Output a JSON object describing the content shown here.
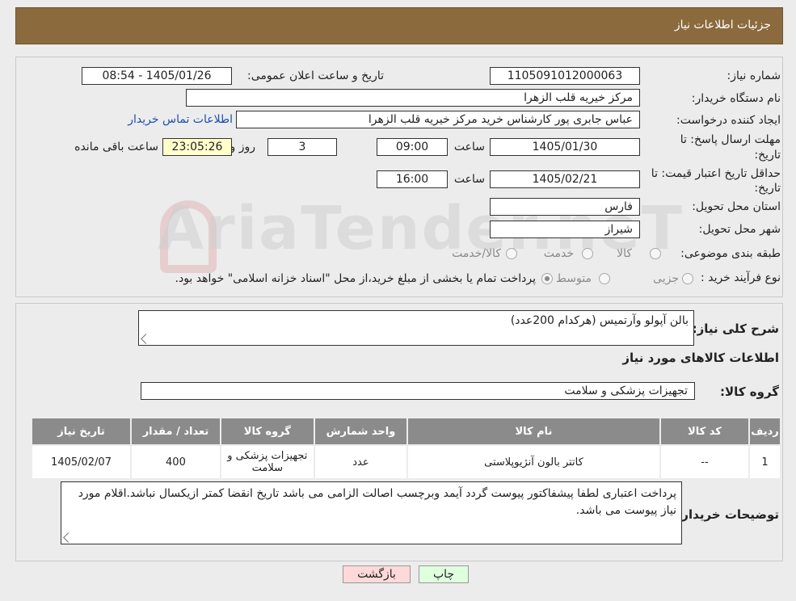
{
  "header": {
    "title": "جزئیات اطلاعات نیاز"
  },
  "form": {
    "need_number_label": "شماره نیاز:",
    "need_number": "1105091012000063",
    "announce_label": "تاریخ و ساعت اعلان عمومی:",
    "announce_value": "1405/01/26 - 08:54",
    "buyer_org_label": "نام دستگاه خریدار:",
    "buyer_org": "مرکز خیریه قلب الزهرا",
    "requester_label": "ایجاد کننده درخواست:",
    "requester": "عباس جابری پور کارشناس خرید مرکز خیریه قلب الزهرا",
    "contact_link": "اطلاعات تماس خریدار",
    "deadline_label_1": "مهلت ارسال پاسخ: تا",
    "deadline_label_2": "تاریخ:",
    "deadline_date": "1405/01/30",
    "time_label": "ساعت",
    "deadline_time": "09:00",
    "days_value": "3",
    "days_label": "روز و",
    "remaining_time": "23:05:26",
    "remaining_label": "ساعت باقی مانده",
    "validity_label_1": "حداقل تاریخ اعتبار قیمت: تا",
    "validity_label_2": "تاریخ:",
    "validity_date": "1405/02/21",
    "validity_time": "16:00",
    "province_label": "استان محل تحویل:",
    "province": "فارس",
    "city_label": "شهر محل تحویل:",
    "city": "شیراز",
    "category_label": "طبقه بندی موضوعی:",
    "category_options": [
      "کالا",
      "خدمت",
      "کالا/خدمت"
    ],
    "process_label": "نوع فرآیند خرید :",
    "process_options": [
      "جزیی",
      "متوسط"
    ],
    "process_note": "پرداخت تمام یا بخشی از مبلغ خرید،از محل \"اسناد خزانه اسلامی\" خواهد بود."
  },
  "details": {
    "description_label": "شرح کلی نیاز:",
    "description": "بالن آپولو وآرتمیس   (هرکدام 200عدد)",
    "items_title": "اطلاعات کالاهای مورد نیاز",
    "group_label": "گروه کالا:",
    "group_value": "تجهیزات پزشکی و سلامت",
    "table": {
      "headers": [
        "ردیف",
        "کد کالا",
        "نام کالا",
        "واحد شمارش",
        "گروه کالا",
        "تعداد / مقدار",
        "تاریخ نیاز"
      ],
      "rows": [
        [
          "1",
          "--",
          "کاتتر بالون آنژیوپلاستی",
          "عدد",
          "تجهیزات پزشکی و سلامت",
          "400",
          "1405/02/07"
        ]
      ]
    },
    "notes_label": "توضیحات خریدار:",
    "notes": "پرداخت اعتباری لطفا پیشفاکتور پیوست گردد آیمد وبرچسب اصالت الزامی می باشد تاریخ انقضا کمتر ازیکسال نباشد.اقلام مورد نیاز پیوست می باشد."
  },
  "buttons": {
    "back": "بازگشت",
    "print": "چاپ"
  },
  "colors": {
    "header": "#8b6a3e",
    "table_header": "#8b8b8b",
    "back_button": "#ffd9d9",
    "print_button": "#dfffdf"
  },
  "watermark": {
    "text": "AriaTender.neT"
  }
}
